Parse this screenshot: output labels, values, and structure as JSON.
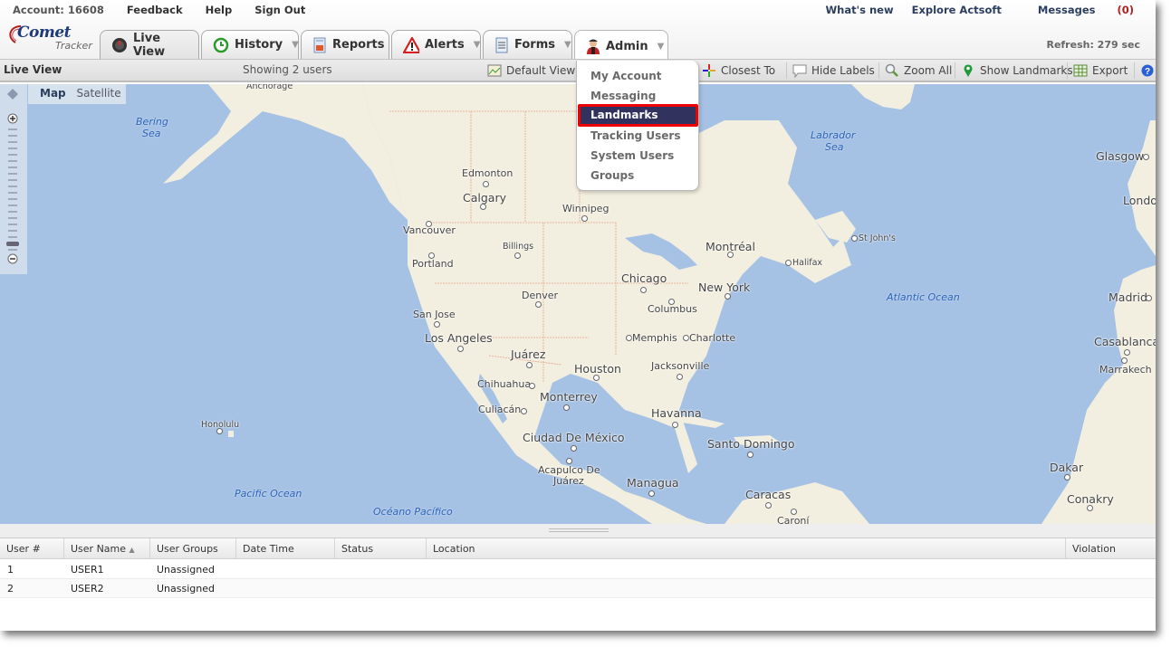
{
  "header": {
    "account": "Account: 16608",
    "links": [
      "Feedback",
      "Help",
      "Sign Out"
    ],
    "right_links": {
      "whats_new": "What's new",
      "explore": "Explore Actsoft",
      "messages": "Messages",
      "messages_count": "(0)"
    },
    "refresh": "Refresh: 279 sec",
    "logo_main": "Comet",
    "logo_sub": "Tracker"
  },
  "tabs": [
    {
      "label": "Live View",
      "icon": "speedometer-icon",
      "dropdown": false
    },
    {
      "label": "History",
      "icon": "clock-history-icon",
      "dropdown": true
    },
    {
      "label": "Reports",
      "icon": "report-icon",
      "dropdown": false
    },
    {
      "label": "Alerts",
      "icon": "alert-triangle-icon",
      "dropdown": true
    },
    {
      "label": "Forms",
      "icon": "form-document-icon",
      "dropdown": true
    },
    {
      "label": "Admin",
      "icon": "admin-user-icon",
      "dropdown": true
    }
  ],
  "toolbar": {
    "title": "Live View",
    "showing": "Showing 2 users",
    "default_view": "Default View",
    "closest_to": "Closest To",
    "hide_labels": "Hide Labels",
    "zoom_all": "Zoom All",
    "show_landmarks": "Show Landmarks",
    "export": "Export"
  },
  "admin_menu": {
    "items": [
      "My Account",
      "Messaging",
      "Landmarks",
      "Tracking Users",
      "System Users",
      "Groups"
    ],
    "highlighted": "Landmarks"
  },
  "map": {
    "types": {
      "map": "Map",
      "satellite": "Satellite"
    },
    "labels": {
      "anchorage": "Anchorage",
      "bering": "Bering",
      "bering2": "Sea",
      "edmonton": "Edmonton",
      "calgary": "Calgary",
      "winnipeg": "Winnipeg",
      "vancouver": "Vancouver",
      "billings": "Billings",
      "portland": "Portland",
      "chicago": "Chicago",
      "montreal": "Montréal",
      "halifax": "Halifax",
      "stjohns": "St John's",
      "newyork": "New York",
      "columbus": "Columbus",
      "denver": "Denver",
      "sanjose": "San Jose",
      "losangeles": "Los Angeles",
      "memphis": "Memphis",
      "charlotte": "Charlotte",
      "juarez": "Juárez",
      "houston": "Houston",
      "jacksonville": "Jacksonville",
      "chihuahua": "Chihuahua",
      "monterrey": "Monterrey",
      "culiacan": "Culiacán",
      "havanna": "Havanna",
      "honolulu": "Honolulu",
      "ciudad": "Ciudad De México",
      "santodomingo": "Santo Domingo",
      "acapulco1": "Acapulco De",
      "acapulco2": "Juárez",
      "managua": "Managua",
      "caracas": "Caracas",
      "caroni": "Caroní",
      "pacific": "Pacific Ocean",
      "oceano": "Océano Pacífico",
      "labrador": "Labrador",
      "labrador2": "Sea",
      "atlantic": "Atlantic Ocean",
      "glasgow": "Glasgow",
      "london": "Londo",
      "madrid": "Madrid",
      "casablanca": "Casablanca",
      "marrakech": "Marrakech",
      "dakar": "Dakar",
      "conakry": "Conakry"
    }
  },
  "grid": {
    "columns": [
      "User #",
      "User Name",
      "User Groups",
      "Date Time",
      "Status",
      "Location",
      "Violation"
    ],
    "sort_column": "User Name",
    "sort_indicator": "▲",
    "rows": [
      {
        "num": "1",
        "name": "USER1",
        "group": "Unassigned",
        "datetime": "",
        "status": "",
        "location": "",
        "violation": ""
      },
      {
        "num": "2",
        "name": "USER2",
        "group": "Unassigned",
        "datetime": "",
        "status": "",
        "location": "",
        "violation": ""
      }
    ]
  },
  "colors": {
    "accent": "#1e3a7a",
    "highlight_bg": "#32325e",
    "highlight_border": "#ee0000",
    "water": "#a5c1e4",
    "land": "#f3efe0"
  }
}
